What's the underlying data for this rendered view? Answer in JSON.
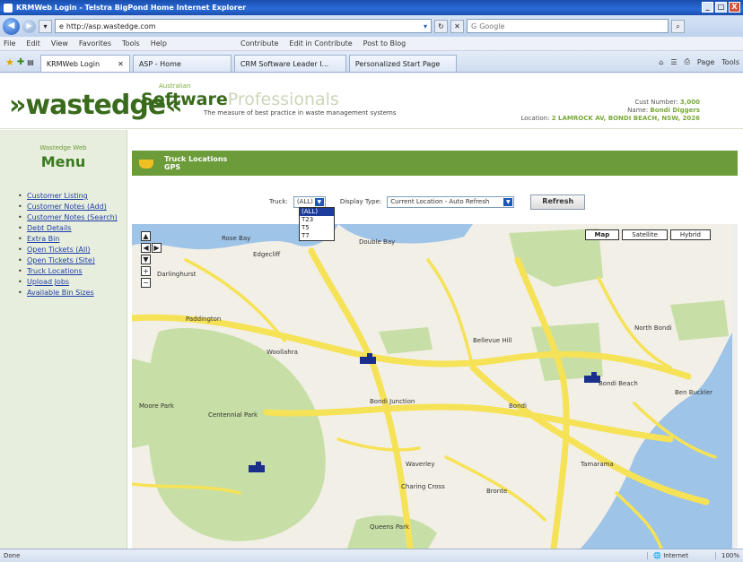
{
  "window": {
    "title": "KRMWeb Login - Telstra BigPond Home Internet Explorer",
    "controls": [
      "_",
      "□",
      "X"
    ]
  },
  "address_bar": {
    "url": "http://asp.wastedge.com",
    "search_placeholder": "Google"
  },
  "menu_bar": {
    "items": [
      "File",
      "Edit",
      "View",
      "Favorites",
      "Tools",
      "Help"
    ],
    "contribute": [
      "Contribute",
      "Edit in Contribute",
      "Post to Blog"
    ]
  },
  "tabs": {
    "items": [
      {
        "label": "KRMWeb Login",
        "active": true
      },
      {
        "label": "ASP - Home",
        "active": false
      },
      {
        "label": "CRM Software Leader I...",
        "active": false
      },
      {
        "label": "Personalized Start Page",
        "active": false
      }
    ],
    "tools": [
      "Page",
      "Tools"
    ]
  },
  "header": {
    "logo": "wastedge",
    "asp_small": "Australian",
    "asp_software": "Software",
    "asp_professionals": "Professionals",
    "asp_tagline": "The measure of best practice in waste management systems",
    "customer_number_label": "Cust Number:",
    "customer_number": "3,000",
    "name_label": "Name:",
    "name": "Bondi Diggers",
    "location_label": "Location:",
    "location": "2 LAMROCK AV, BONDI BEACH, NSW, 2026"
  },
  "sidebar": {
    "subtitle": "Wastedge Web",
    "title": "Menu",
    "items": [
      "Customer Listing",
      "Customer Notes (Add)",
      "Customer Notes (Search)",
      "Debt Details",
      "Extra Bin",
      "Open Tickets (All)",
      "Open Tickets (Site)",
      "Truck Locations",
      "Upload Jobs",
      "Available Bin Sizes"
    ]
  },
  "banner": {
    "title": "Truck Locations",
    "subtitle": "GPS"
  },
  "controls": {
    "truck_label": "Truck:",
    "truck_value": "(ALL)",
    "truck_options": [
      "(ALL)",
      "T23",
      "T5",
      "T7"
    ],
    "display_label": "Display Type:",
    "display_value": "Current Location - Auto Refresh",
    "refresh_label": "Refresh"
  },
  "map": {
    "type_buttons": [
      "Map",
      "Satellite",
      "Hybrid"
    ],
    "zoom_controls": [
      "▲",
      "◀",
      "▶",
      "▼",
      "+",
      "−"
    ],
    "place_labels": [
      "Double Bay",
      "Edgecliff",
      "Paddington",
      "Woollahra",
      "Bellevue Hill",
      "Bondi Junction",
      "Bondi",
      "Bondi Beach",
      "Moore Park",
      "Centennial Park",
      "Waverley",
      "Charing Cross",
      "Queens Park",
      "Bronte",
      "Tamarama",
      "Darlinghurst",
      "North Bondi",
      "Ben Buckler",
      "Rose Bay"
    ],
    "colors": {
      "water": "#9ec4e8",
      "park": "#c7dfa6",
      "road": "#f6e256",
      "land": "#f2efe6"
    }
  },
  "statusbar": {
    "left": "Done",
    "zone": "Internet",
    "zoom": "100%"
  },
  "colors": {
    "brand_green": "#3a6b1c",
    "banner_green": "#6c9b3a",
    "sidebar_bg": "#e8eedd"
  }
}
